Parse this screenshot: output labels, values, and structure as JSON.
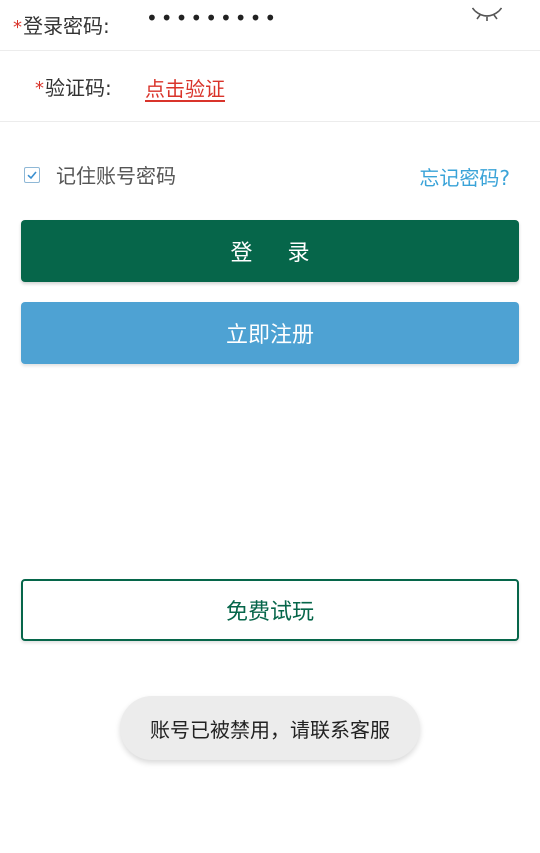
{
  "password_field": {
    "required_mark": "*",
    "label": "登录密码:",
    "value": "•••••••••",
    "toggle_icon": "eye-closed-icon"
  },
  "captcha_field": {
    "required_mark": "*",
    "label": "验证码:",
    "action_label": "点击验证"
  },
  "remember": {
    "checked": true,
    "label": "记住账号密码"
  },
  "forgot_password_label": "忘记密码?",
  "buttons": {
    "login": "登 录",
    "register": "立即注册",
    "trial": "免费试玩"
  },
  "toast": {
    "message": "账号已被禁用，请联系客服"
  },
  "colors": {
    "primary_green": "#06664a",
    "register_blue": "#4ea2d3",
    "link_blue": "#3aa3d8",
    "required_red": "#d9342b"
  }
}
